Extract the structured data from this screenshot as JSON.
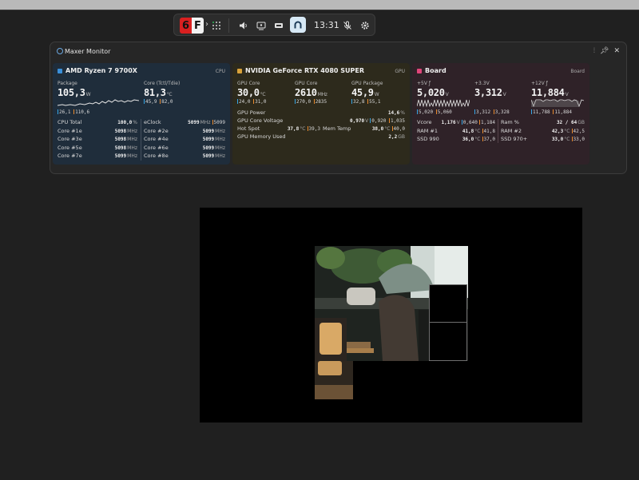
{
  "gamebar": {
    "badge_left": "6",
    "badge_right": "F",
    "time": "13:31",
    "icons": [
      "chevron-right-icon",
      "widget-grid-icon",
      "volume-icon",
      "capture-icon",
      "performance-icon",
      "monitor-app-icon",
      "mic-off-icon",
      "gear-icon"
    ]
  },
  "monitor": {
    "title": "Maxer Monitor",
    "colors": {
      "cpu": "#3a8fd9",
      "gpu": "#d9a23a",
      "board": "#e0457a"
    },
    "cpu": {
      "name": "AMD Ryzen 7 9700X",
      "tag": "CPU",
      "package_label": "Package",
      "package_value": "105,3",
      "package_unit": "W",
      "package_min": "26,1",
      "package_max": "110,6",
      "core_label": "Core (Tctl/Tdie)",
      "core_value": "81,3",
      "core_unit": "°C",
      "core_min": "45,9",
      "core_max": "82,0",
      "rows": [
        {
          "l1": "CPU Total",
          "v1": "100,0",
          "u1": "%",
          "l2": "eClock",
          "v2": "5099",
          "u2": "MHz",
          "v3": "5099"
        },
        {
          "l1": "Core #1e",
          "v1": "5098",
          "u1": "MHz",
          "l2": "Core #2e",
          "v2": "5099",
          "u2": "MHz",
          "v3": ""
        },
        {
          "l1": "Core #3e",
          "v1": "5098",
          "u1": "MHz",
          "l2": "Core #4e",
          "v2": "5099",
          "u2": "MHz",
          "v3": ""
        },
        {
          "l1": "Core #5e",
          "v1": "5098",
          "u1": "MHz",
          "l2": "Core #6e",
          "v2": "5099",
          "u2": "MHz",
          "v3": ""
        },
        {
          "l1": "Core #7e",
          "v1": "5099",
          "u1": "MHz",
          "l2": "Core #8e",
          "v2": "5099",
          "u2": "MHz",
          "v3": ""
        }
      ]
    },
    "gpu": {
      "name": "NVIDIA GeForce RTX 4080 SUPER",
      "tag": "GPU",
      "m1_label": "GPU Core",
      "m1_value": "30,0",
      "m1_unit": "°C",
      "m1_min": "24,0",
      "m1_max": "31,0",
      "m2_label": "GPU Core",
      "m2_value": "2610",
      "m2_unit": "MHz",
      "m2_min": "270,0",
      "m2_max": "2835",
      "m3_label": "GPU Package",
      "m3_value": "45,9",
      "m3_unit": "W",
      "m3_min": "32,8",
      "m3_max": "55,1",
      "power_label": "GPU Power",
      "power_value": "14,6",
      "power_unit": "%",
      "voltage_label": "GPU Core Voltage",
      "voltage_value": "0,970",
      "voltage_unit": "V",
      "voltage_min": "0,920",
      "voltage_max": "1,035",
      "hotspot_label": "Hot Spot",
      "hotspot_value": "37,8",
      "hotspot_unit": "°C",
      "hotspot_max": "39,3",
      "memtemp_label": "Mem Temp",
      "memtemp_value": "38,0",
      "memtemp_unit": "°C",
      "memtemp_max": "40,0",
      "memused_label": "GPU Memory Used",
      "memused_value": "2,2",
      "memused_unit": "GB"
    },
    "board": {
      "name": "Board",
      "tag": "Board",
      "m1_label": "+5V ƒ",
      "m1_value": "5,020",
      "m1_unit": "V",
      "m1_min": "5,020",
      "m1_max": "5,060",
      "m2_label": "+3.3V",
      "m2_value": "3,312",
      "m2_unit": "V",
      "m2_min": "3,312",
      "m2_max": "3,328",
      "m3_label": "+12V ƒ",
      "m3_value": "11,884",
      "m3_unit": "V",
      "m3_min": "11,788",
      "m3_max": "11,884",
      "rows": [
        {
          "l1": "Vcore",
          "v1": "1,176",
          "u1": "V",
          "x1": "0,640",
          "y1": "1,184",
          "l2": "Ram %",
          "v2": "32 / 64",
          "u2": "GB",
          "x2": ""
        },
        {
          "l1": "RAM #1",
          "v1": "41,8",
          "u1": "°C",
          "x1": "41,8",
          "y1": "",
          "l2": "RAM #2",
          "v2": "42,3",
          "u2": "°C",
          "x2": "42,5"
        },
        {
          "l1": "SSD 990",
          "v1": "36,0",
          "u1": "°C",
          "x1": "37,0",
          "y1": "",
          "l2": "SSD 970+",
          "v2": "33,0",
          "u2": "°C",
          "x2": "33,0"
        }
      ]
    }
  }
}
